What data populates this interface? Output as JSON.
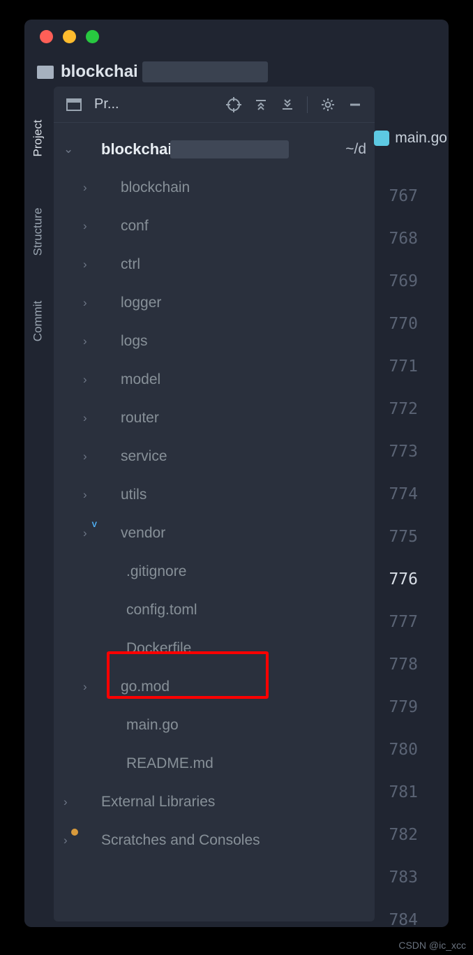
{
  "breadcrumb": {
    "project_name": "blockchai"
  },
  "panel": {
    "title": "Pr..."
  },
  "sidebar": {
    "items": [
      {
        "label": "Project"
      },
      {
        "label": "Structure"
      },
      {
        "label": "Commit"
      }
    ]
  },
  "tree": {
    "root": {
      "name": "blockchai",
      "suffix": "~/d"
    },
    "children": [
      {
        "type": "folder",
        "name": "blockchain"
      },
      {
        "type": "folder",
        "name": "conf"
      },
      {
        "type": "folder",
        "name": "ctrl"
      },
      {
        "type": "folder",
        "name": "logger"
      },
      {
        "type": "folder",
        "name": "logs"
      },
      {
        "type": "folder",
        "name": "model"
      },
      {
        "type": "folder",
        "name": "router"
      },
      {
        "type": "folder",
        "name": "service"
      },
      {
        "type": "folder",
        "name": "utils"
      },
      {
        "type": "vendor",
        "name": "vendor"
      },
      {
        "type": "file",
        "name": ".gitignore",
        "icon": "file"
      },
      {
        "type": "file",
        "name": "config.toml",
        "icon": "file"
      },
      {
        "type": "file",
        "name": "Dockerfile",
        "icon": "docker",
        "highlighted": true
      },
      {
        "type": "file",
        "name": "go.mod",
        "icon": "file",
        "expandable": true
      },
      {
        "type": "file",
        "name": "main.go",
        "icon": "go"
      },
      {
        "type": "file",
        "name": "README.md",
        "icon": "md"
      }
    ],
    "extras": [
      {
        "name": "External Libraries",
        "icon": "lib"
      },
      {
        "name": "Scratches and Consoles",
        "icon": "scratch"
      }
    ]
  },
  "editor": {
    "open_tab": "main.go",
    "line_numbers": [
      767,
      768,
      769,
      770,
      771,
      772,
      773,
      774,
      775,
      776,
      777,
      778,
      779,
      780,
      781,
      782,
      783,
      784
    ],
    "active_line": 776
  },
  "watermark": "CSDN @ic_xcc"
}
